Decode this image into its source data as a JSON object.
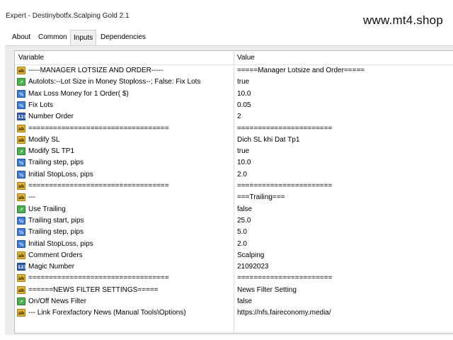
{
  "window": {
    "title": "Expert - Destinybotfx.Scalping Gold 2.1",
    "watermark": "www.mt4.shop"
  },
  "tabs": [
    {
      "label": "About",
      "active": false
    },
    {
      "label": "Common",
      "active": false
    },
    {
      "label": "Inputs",
      "active": true
    },
    {
      "label": "Dependencies",
      "active": false
    }
  ],
  "columns": {
    "variable": "Variable",
    "value": "Value"
  },
  "rows": [
    {
      "icon": "ab",
      "variable": "-----MANAGER LOTSIZE AND ORDER-----",
      "value": "=====Manager Lotsize and Order====="
    },
    {
      "icon": "bool",
      "variable": "Autolots:--Lot Size in Money Stoploss--; False: Fix Lots",
      "value": "true"
    },
    {
      "icon": "dbl",
      "variable": "Max Loss Money for 1 Order( $)",
      "value": "10.0"
    },
    {
      "icon": "dbl",
      "variable": "Fix Lots",
      "value": "0.05"
    },
    {
      "icon": "int",
      "variable": "Number Order",
      "value": "2"
    },
    {
      "icon": "ab",
      "variable": "==================================",
      "value": "======================="
    },
    {
      "icon": "ab",
      "variable": "Modify SL",
      "value": "Dich SL khi Dat Tp1"
    },
    {
      "icon": "bool",
      "variable": "Modify SL TP1",
      "value": "true"
    },
    {
      "icon": "dbl",
      "variable": "Trailing step, pips",
      "value": "10.0"
    },
    {
      "icon": "dbl",
      "variable": "Initial StopLoss, pips",
      "value": "2.0"
    },
    {
      "icon": "ab",
      "variable": "==================================",
      "value": "======================="
    },
    {
      "icon": "ab",
      "variable": "---",
      "value": "===Trailing==="
    },
    {
      "icon": "bool",
      "variable": "Use Trailing",
      "value": "false"
    },
    {
      "icon": "dbl",
      "variable": "Trailing start, pips",
      "value": "25.0"
    },
    {
      "icon": "dbl",
      "variable": "Trailing step, pips",
      "value": "5.0"
    },
    {
      "icon": "dbl",
      "variable": "Initial StopLoss, pips",
      "value": "2.0"
    },
    {
      "icon": "ab",
      "variable": "Comment Orders",
      "value": "Scalping"
    },
    {
      "icon": "int",
      "variable": "Magic Number",
      "value": "21092023"
    },
    {
      "icon": "ab",
      "variable": "==================================",
      "value": "======================="
    },
    {
      "icon": "ab",
      "variable": "======NEWS FILTER SETTINGS=====",
      "value": "News Filter Setting"
    },
    {
      "icon": "bool",
      "variable": "On/Off News Filter",
      "value": "false"
    },
    {
      "icon": "ab",
      "variable": "--- Link Forexfactory News (Manual Tools\\Options)",
      "value": "https://nfs.faireconomy.media/"
    }
  ],
  "icon_glyphs": {
    "ab": "ab",
    "bool": "↗",
    "dbl": "½",
    "int": "123"
  }
}
